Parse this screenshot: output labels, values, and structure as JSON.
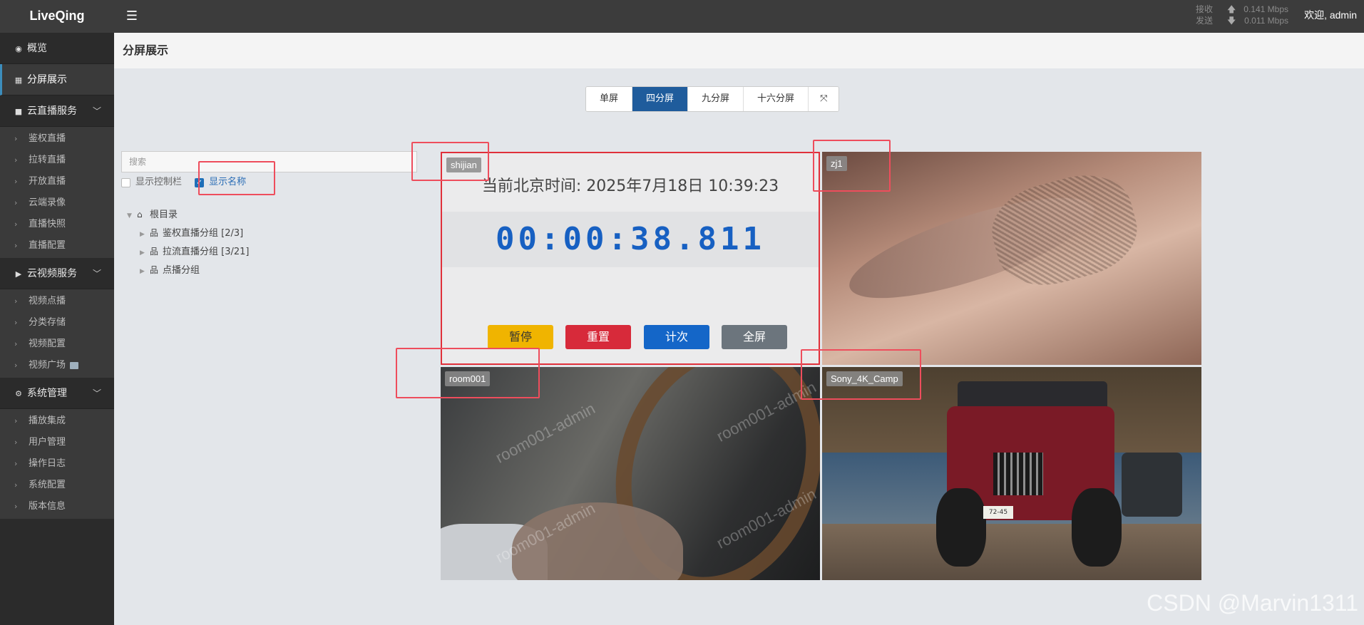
{
  "app": {
    "logo": "LiveQing",
    "menu_icon": "hamburger-icon"
  },
  "network": {
    "recv_label": "接收",
    "recv_value": "0.141 Mbps",
    "send_label": "发送",
    "send_value": "0.011 Mbps"
  },
  "user": {
    "welcome": "欢迎, admin"
  },
  "sidebar": {
    "overview": "概览",
    "split": "分屏展示",
    "live_group": "云直播服务",
    "live_items": [
      "鉴权直播",
      "拉转直播",
      "开放直播",
      "云端录像",
      "直播快照",
      "直播配置"
    ],
    "vod_group": "云视频服务",
    "vod_items": [
      "视频点播",
      "分类存储",
      "视频配置",
      "视频广场"
    ],
    "sys_group": "系统管理",
    "sys_items": [
      "播放集成",
      "用户管理",
      "操作日志",
      "系统配置",
      "版本信息"
    ]
  },
  "page": {
    "title": "分屏展示"
  },
  "split_buttons": {
    "single": "单屏",
    "four": "四分屏",
    "nine": "九分屏",
    "sixteen": "十六分屏",
    "active": "四分屏"
  },
  "panel": {
    "search_placeholder": "搜索",
    "show_controls": "显示控制栏",
    "show_controls_checked": false,
    "show_names": "显示名称",
    "show_names_checked": true
  },
  "tree": {
    "root": "根目录",
    "children": [
      "鉴权直播分组 [2/3]",
      "拉流直播分组 [3/21]",
      "点播分组"
    ]
  },
  "cells": [
    {
      "name": "shijian"
    },
    {
      "name": "zj1"
    },
    {
      "name": "room001"
    },
    {
      "name": "Sony_4K_Camp"
    }
  ],
  "clock": {
    "time_text": "当前北京时间: 2025年7月18日 10:39:23",
    "timer": "00:00:38.811",
    "pause": "暂停",
    "reset": "重置",
    "count": "计次",
    "full": "全屏"
  },
  "room001_watermark": "room001-admin",
  "plate_text": "72-45",
  "footer_watermark": "CSDN @Marvin1311",
  "colors": {
    "accent": "#1f5c9c",
    "sidebar": "#2b2b2b",
    "topbar": "#3c3c3c",
    "annotation": "#ee4d5c"
  }
}
